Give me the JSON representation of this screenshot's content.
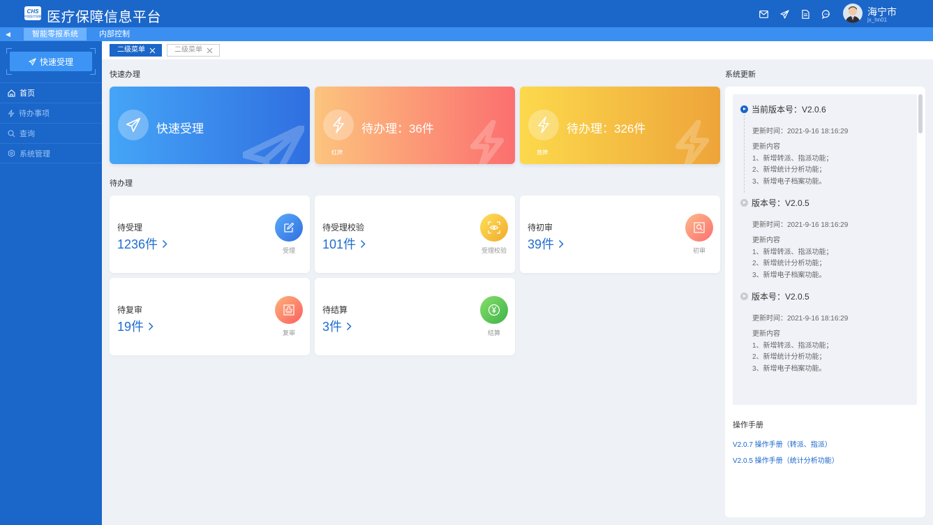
{
  "header": {
    "logo_text": "CHS",
    "logo_subtext": "中国医疗保障",
    "title": "医疗保障信息平台",
    "icons": [
      "mail-icon",
      "send-icon",
      "document-icon",
      "chat-icon"
    ],
    "user": {
      "name": "海宁市",
      "id": "jx_hn01"
    }
  },
  "subnav": {
    "tabs": [
      "智能零报系统",
      "内部控制"
    ]
  },
  "sidebar": {
    "quick_button": "快速受理",
    "items": [
      {
        "label": "首页",
        "icon": "home-icon"
      },
      {
        "label": "待办事项",
        "icon": "bolt-icon"
      },
      {
        "label": "查询",
        "icon": "search-icon"
      },
      {
        "label": "系统管理",
        "icon": "gear-icon"
      }
    ]
  },
  "tabs": [
    {
      "label": "二级菜单",
      "active": true
    },
    {
      "label": "二级菜单",
      "active": false
    }
  ],
  "quick": {
    "title": "快速办理",
    "cards": [
      {
        "text": "快速受理",
        "sub": ""
      },
      {
        "text": "待办理：36件",
        "sub": "红牌"
      },
      {
        "text": "待办理：326件",
        "sub": "黄牌"
      }
    ]
  },
  "pending": {
    "title": "待办理",
    "cards": [
      {
        "label": "待受理",
        "value": "1236件",
        "caption": "受理",
        "color": "#2f80ed"
      },
      {
        "label": "待受理校验",
        "value": "101件",
        "caption": "受理校验",
        "color": "#f5c22b"
      },
      {
        "label": "待初审",
        "value": "39件",
        "caption": "初审",
        "color": "#fb8a79"
      },
      {
        "label": "待复审",
        "value": "19件",
        "caption": "复审",
        "color": "#fb7a64"
      },
      {
        "label": "待结算",
        "value": "3件",
        "caption": "结算",
        "color": "#55c45a"
      }
    ]
  },
  "updates": {
    "title": "系统更新",
    "versions": [
      {
        "label": "当前版本号：V2.0.6",
        "time": "更新时间：2021-9-16  18:16:29",
        "content_title": "更新内容",
        "items": [
          "1、新增转派、指派功能；",
          "2、新增统计分析功能；",
          "3、新增电子档案功能。"
        ]
      },
      {
        "label": "版本号：V2.0.5",
        "time": "更新时间：2021-9-16  18:16:29",
        "content_title": "更新内容",
        "items": [
          "1、新增转派、指派功能；",
          "2、新增统计分析功能；",
          "3、新增电子档案功能。"
        ]
      },
      {
        "label": "版本号：V2.0.5",
        "time": "更新时间：2021-9-16  18:16:29",
        "content_title": "更新内容",
        "items": [
          "1、新增转派、指派功能；",
          "2、新增统计分析功能；",
          "3、新增电子档案功能。"
        ]
      }
    ],
    "manual_title": "操作手册",
    "manuals": [
      "V2.0.7  操作手册（转派、指派）",
      "V2.0.5  操作手册（统计分析功能）"
    ]
  }
}
